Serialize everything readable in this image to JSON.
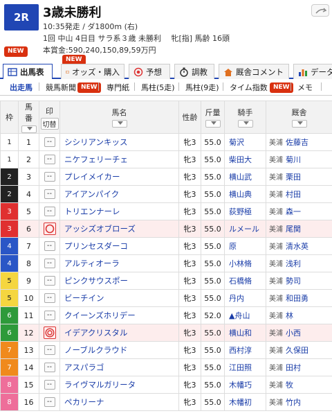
{
  "header": {
    "race_no": "2R",
    "title": "3歳未勝利",
    "time": "10:35発走 / ダ1800m (右)",
    "info": "1回 中山 4日目 サラ系３歳 未勝利　 牝[指] 馬齢 16頭",
    "prize": "本賞金:590,240,150,89,59万円"
  },
  "main_tabs": [
    {
      "label": "出馬表",
      "new": "NEW"
    },
    {
      "label": "オッズ・購入",
      "new": "NEW"
    },
    {
      "label": "予想",
      "new": ""
    },
    {
      "label": "調教",
      "new": ""
    },
    {
      "label": "厩舎コメント",
      "new": ""
    },
    {
      "label": "データ",
      "new": ""
    }
  ],
  "sub_tabs": [
    {
      "label": "出走馬",
      "new": ""
    },
    {
      "label": "競馬新聞",
      "new": "NEW"
    },
    {
      "label": "専門紙",
      "new": ""
    },
    {
      "label": "馬柱(5走)",
      "new": ""
    },
    {
      "label": "馬柱(9走)",
      "new": ""
    },
    {
      "label": "タイム指数",
      "new": "NEW"
    },
    {
      "label": "メモ",
      "new": ""
    }
  ],
  "table": {
    "headers": {
      "frame": "枠",
      "num_1": "馬",
      "num_2": "番",
      "mark": "印",
      "mark_toggle": "切替",
      "name": "馬名",
      "sexage": "性齢",
      "weight_1": "斤",
      "weight_2": "量",
      "jockey": "騎手",
      "stable": "厩舎"
    },
    "rows": [
      {
        "frame": "1",
        "num": "1",
        "mark": "--",
        "name": "シシリアンキッス",
        "sexage": "牝3",
        "weight": "55.0",
        "jockey": "菊沢",
        "region": "美浦",
        "trainer": "佐藤吉"
      },
      {
        "frame": "1",
        "num": "2",
        "mark": "--",
        "name": "ニケフェリーチェ",
        "sexage": "牝3",
        "weight": "55.0",
        "jockey": "柴田大",
        "region": "美浦",
        "trainer": "菊川"
      },
      {
        "frame": "2",
        "num": "3",
        "mark": "--",
        "name": "プレイメイカー",
        "sexage": "牝3",
        "weight": "55.0",
        "jockey": "横山武",
        "region": "美浦",
        "trainer": "栗田"
      },
      {
        "frame": "2",
        "num": "4",
        "mark": "--",
        "name": "アイアンパイク",
        "sexage": "牝3",
        "weight": "55.0",
        "jockey": "横山典",
        "region": "美浦",
        "trainer": "村田"
      },
      {
        "frame": "3",
        "num": "5",
        "mark": "--",
        "name": "トリエンナーレ",
        "sexage": "牝3",
        "weight": "55.0",
        "jockey": "荻野極",
        "region": "美浦",
        "trainer": "森一"
      },
      {
        "frame": "3",
        "num": "6",
        "mark": "circle",
        "name": "アッシズオブローズ",
        "sexage": "牝3",
        "weight": "55.0",
        "jockey": "ルメール",
        "region": "美浦",
        "trainer": "尾関"
      },
      {
        "frame": "4",
        "num": "7",
        "mark": "--",
        "name": "プリンセスダーコ",
        "sexage": "牝3",
        "weight": "55.0",
        "jockey": "原",
        "region": "美浦",
        "trainer": "清水英"
      },
      {
        "frame": "4",
        "num": "8",
        "mark": "--",
        "name": "アルティオーラ",
        "sexage": "牝3",
        "weight": "55.0",
        "jockey": "小林脩",
        "region": "美浦",
        "trainer": "浅利"
      },
      {
        "frame": "5",
        "num": "9",
        "mark": "--",
        "name": "ピンクサウスポー",
        "sexage": "牝3",
        "weight": "55.0",
        "jockey": "石橋脩",
        "region": "美浦",
        "trainer": "勢司"
      },
      {
        "frame": "5",
        "num": "10",
        "mark": "--",
        "name": "ビーチイン",
        "sexage": "牝3",
        "weight": "55.0",
        "jockey": "丹内",
        "region": "美浦",
        "trainer": "和田勇"
      },
      {
        "frame": "6",
        "num": "11",
        "mark": "--",
        "name": "クイーンズホリデー",
        "sexage": "牝3",
        "weight": "52.0",
        "jockey": "▲舟山",
        "region": "美浦",
        "trainer": "林"
      },
      {
        "frame": "6",
        "num": "12",
        "mark": "double",
        "name": "イデアクリスタル",
        "sexage": "牝3",
        "weight": "55.0",
        "jockey": "横山和",
        "region": "美浦",
        "trainer": "小西"
      },
      {
        "frame": "7",
        "num": "13",
        "mark": "--",
        "name": "ノーブルクラウド",
        "sexage": "牝3",
        "weight": "55.0",
        "jockey": "西村淳",
        "region": "美浦",
        "trainer": "久保田"
      },
      {
        "frame": "7",
        "num": "14",
        "mark": "--",
        "name": "アスパラゴ",
        "sexage": "牝3",
        "weight": "55.0",
        "jockey": "江田照",
        "region": "美浦",
        "trainer": "田村"
      },
      {
        "frame": "8",
        "num": "15",
        "mark": "--",
        "name": "ライヴマルガリータ",
        "sexage": "牝3",
        "weight": "55.0",
        "jockey": "木幡巧",
        "region": "美浦",
        "trainer": "牧"
      },
      {
        "frame": "8",
        "num": "16",
        "mark": "--",
        "name": "ペカリーナ",
        "sexage": "牝3",
        "weight": "55.0",
        "jockey": "木幡初",
        "region": "美浦",
        "trainer": "竹内"
      }
    ]
  },
  "colors": {
    "frame_bg": {
      "1": "#ffffff",
      "2": "#222222",
      "3": "#e03030",
      "4": "#2a56c6",
      "5": "#f5d640",
      "6": "#2e9a3a",
      "7": "#f08a1c",
      "8": "#ee6e9a"
    },
    "frame_fg": {
      "1": "#222222",
      "2": "#ffffff",
      "3": "#ffffff",
      "4": "#ffffff",
      "5": "#222222",
      "6": "#ffffff",
      "7": "#ffffff",
      "8": "#ffffff"
    },
    "accent": "#2046b4",
    "new_badge": "#d9300f"
  }
}
